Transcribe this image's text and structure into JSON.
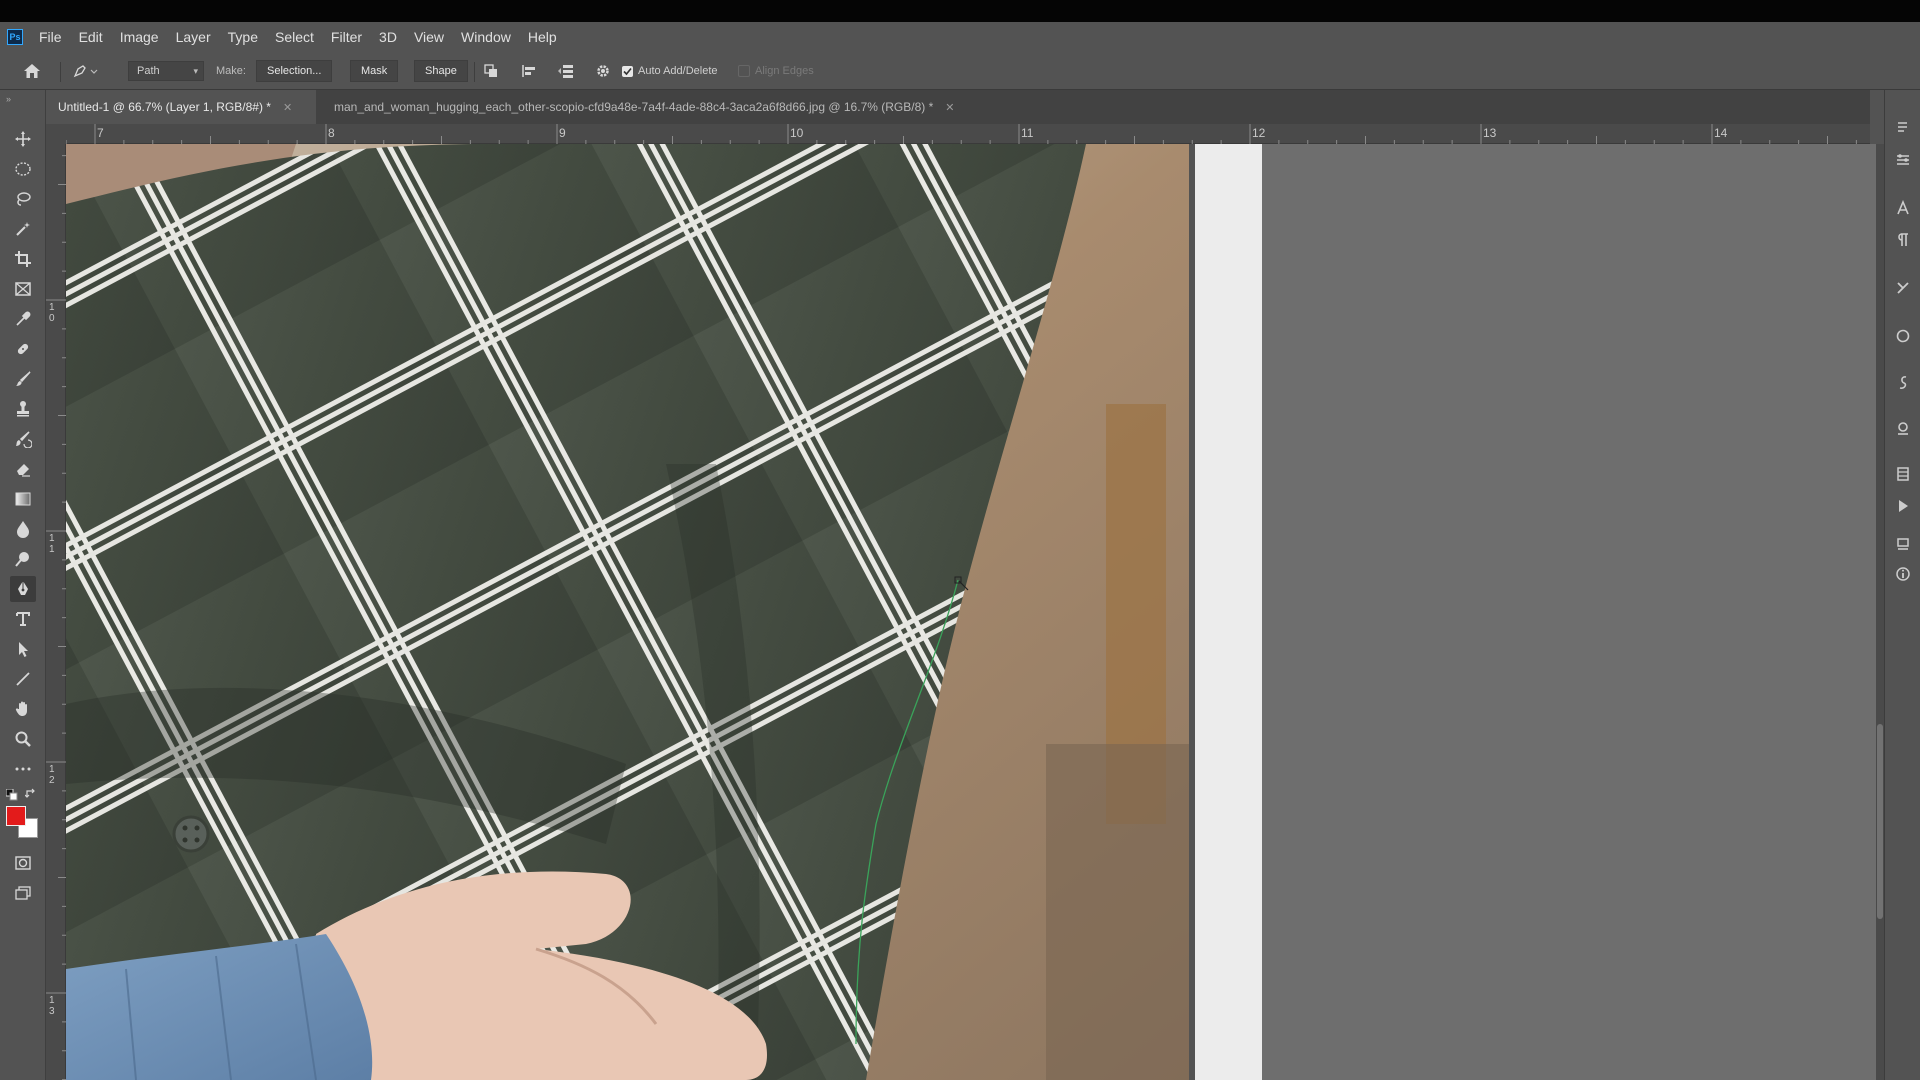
{
  "menubar": {
    "app_logo": "Ps",
    "items": [
      "File",
      "Edit",
      "Image",
      "Layer",
      "Type",
      "Select",
      "Filter",
      "3D",
      "View",
      "Window",
      "Help"
    ]
  },
  "options": {
    "tool_mode": "Path",
    "make_label": "Make:",
    "selection_button": "Selection...",
    "mask_button": "Mask",
    "shape_button": "Shape",
    "auto_add_delete": {
      "label": "Auto Add/Delete",
      "checked": true
    },
    "align_edges": "Align Edges"
  },
  "tabs": [
    {
      "title": "Untitled-1 @ 66.7% (Layer 1, RGB/8#) *",
      "active": true
    },
    {
      "title": "man_and_woman_hugging_each_other-scopio-cfd9a48e-7a4f-4ade-88c4-3aca2a6f8d66.jpg @ 16.7% (RGB/8) *",
      "active": false
    }
  ],
  "ruler": {
    "horizontal": [
      "7",
      "8",
      "9",
      "10",
      "11",
      "12",
      "13",
      "14"
    ],
    "vertical": [
      "1\n0",
      "1\n1",
      "1\n2",
      "1\n3"
    ]
  },
  "colors": {
    "foreground": "#e31b1b",
    "background": "#ffffff",
    "accent": "#31a8ff"
  },
  "tools": [
    "move-icon",
    "marquee-icon",
    "lasso-icon",
    "magic-wand-icon",
    "crop-icon",
    "frame-icon",
    "eyedropper-icon",
    "healing-brush-icon",
    "brush-icon",
    "clone-stamp-icon",
    "history-brush-icon",
    "eraser-icon",
    "gradient-icon",
    "blur-icon",
    "dodge-icon",
    "pen-icon",
    "type-icon",
    "path-selection-icon",
    "line-icon",
    "hand-icon",
    "zoom-icon",
    "more-tools-icon"
  ]
}
